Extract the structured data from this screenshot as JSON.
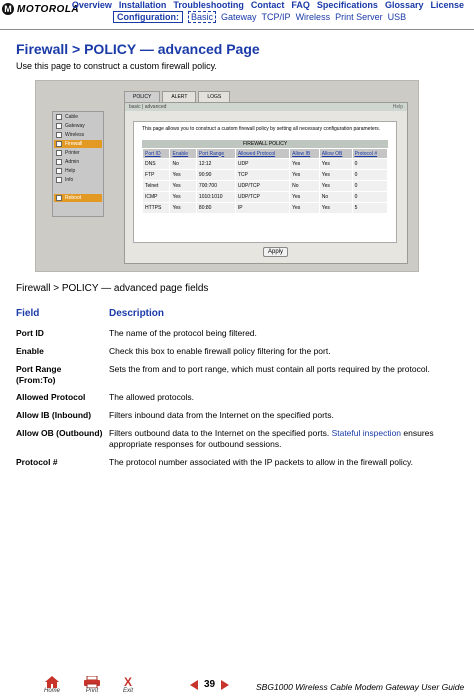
{
  "brand": {
    "logo_mark": "M",
    "logo_text": "MOTOROLA"
  },
  "top_nav": [
    "Overview",
    "Installation",
    "Troubleshooting",
    "Contact",
    "FAQ",
    "Specifications",
    "Glossary",
    "License"
  ],
  "config_nav": {
    "label": "Configuration:",
    "items": [
      "Basic",
      "Gateway",
      "TCP/IP",
      "Wireless",
      "Print Server",
      "USB"
    ]
  },
  "page": {
    "title": "Firewall > POLICY — advanced Page",
    "intro": "Use this page to construct a custom firewall policy."
  },
  "screenshot": {
    "sidebar": [
      "Cable",
      "Gateway",
      "Wireless",
      "Firewall",
      "Printer",
      "Admin",
      "Help",
      "Info",
      "",
      "Reboot"
    ],
    "tabs": [
      "POLICY",
      "ALERT",
      "LOGS"
    ],
    "panel_header": "basic | advanced",
    "help_link": "Help",
    "description": "This page allows you to construct a custom firewall policy by setting all necessary configuration parameters.",
    "table_title": "FIREWALL POLICY",
    "columns": [
      "Port ID",
      "Enable",
      "Port Range",
      "Allowed Protocol",
      "Allow IB",
      "Allow OB",
      "Protocol #"
    ],
    "rows": [
      [
        "DNS",
        "No",
        "12:12",
        "UDP",
        "Yes",
        "Yes",
        "0"
      ],
      [
        "FTP",
        "Yes",
        "90:90",
        "TCP",
        "Yes",
        "Yes",
        "0"
      ],
      [
        "Telnet",
        "Yes",
        "700:700",
        "UDP/TCP",
        "No",
        "Yes",
        "0"
      ],
      [
        "ICMP",
        "Yes",
        "1010:1010",
        "UDP/TCP",
        "Yes",
        "No",
        "0"
      ],
      [
        "HTTPS",
        "Yes",
        "80:80",
        "IP",
        "Yes",
        "Yes",
        "5"
      ]
    ],
    "apply_label": "Apply"
  },
  "fields_section": {
    "title": "Firewall > POLICY — advanced page fields",
    "col_field": "Field",
    "col_desc": "Description",
    "rows": [
      {
        "field": "Port ID",
        "desc": "The name of the protocol being filtered."
      },
      {
        "field": "Enable",
        "desc": "Check this box to enable firewall policy filtering for the port."
      },
      {
        "field": "Port Range (From:To)",
        "desc": "Sets the from and to port range, which must contain all ports required by the protocol."
      },
      {
        "field": "Allowed Protocol",
        "desc": "The allowed protocols."
      },
      {
        "field": "Allow IB (Inbound)",
        "desc": "Filters inbound data from the Internet on the specified ports."
      },
      {
        "field": "Allow OB (Outbound)",
        "desc_a": "Filters outbound data to the Internet on the specified ports. ",
        "desc_link": "Stateful inspection",
        "desc_b": " ensures appropriate responses for outbound sessions."
      },
      {
        "field": "Protocol #",
        "desc": "The protocol number associated with the IP packets to allow in the firewall policy."
      }
    ]
  },
  "footer": {
    "home": "Home",
    "print": "Print",
    "exit": "Exit",
    "exit_glyph": "X",
    "page_number": "39",
    "guide_title": "SBG1000 Wireless Cable Modem Gateway User Guide"
  },
  "colors": {
    "accent": "#1a3aa8",
    "highlight": "#e39a25"
  },
  "icons": [
    "home-icon",
    "print-icon",
    "exit-icon",
    "prev-arrow-icon",
    "next-arrow-icon"
  ]
}
